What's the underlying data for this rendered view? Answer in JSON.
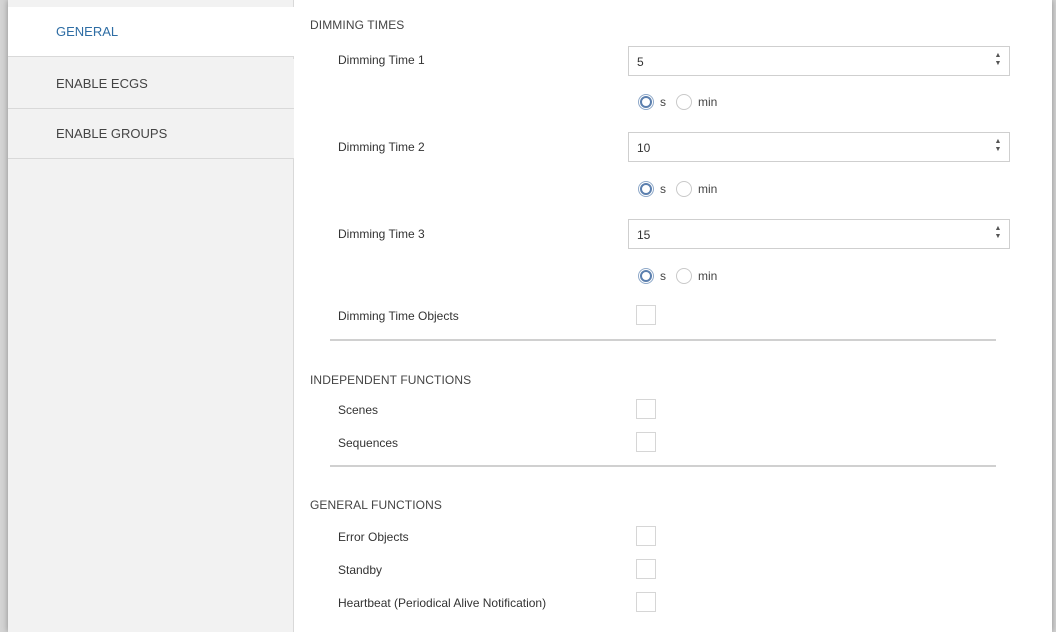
{
  "sidebar": {
    "items": [
      {
        "label": "GENERAL",
        "active": true
      },
      {
        "label": "ENABLE ECGS",
        "active": false
      },
      {
        "label": "ENABLE GROUPS",
        "active": false
      }
    ]
  },
  "dimming_times": {
    "title": "DIMMING TIMES",
    "rows": [
      {
        "label": "Dimming Time 1",
        "value": "5",
        "unit_options": [
          "s",
          "min"
        ],
        "selected_unit": "s"
      },
      {
        "label": "Dimming Time 2",
        "value": "10",
        "unit_options": [
          "s",
          "min"
        ],
        "selected_unit": "s"
      },
      {
        "label": "Dimming Time 3",
        "value": "15",
        "unit_options": [
          "s",
          "min"
        ],
        "selected_unit": "s"
      }
    ],
    "objects_label": "Dimming Time Objects",
    "objects_checked": false
  },
  "independent_functions": {
    "title": "INDEPENDENT FUNCTIONS",
    "items": [
      {
        "label": "Scenes",
        "checked": false
      },
      {
        "label": "Sequences",
        "checked": false
      }
    ]
  },
  "general_functions": {
    "title": "GENERAL FUNCTIONS",
    "items": [
      {
        "label": "Error Objects",
        "checked": false
      },
      {
        "label": "Standby",
        "checked": false
      },
      {
        "label": "Heartbeat (Periodical Alive Notification)",
        "checked": false
      }
    ]
  },
  "colors": {
    "active_nav_text": "#2e6da4",
    "sidebar_bg": "#f2f2f2",
    "radio_selected": "#5b7fae"
  },
  "icons": {
    "spinner": "spin-up-down-icon"
  }
}
